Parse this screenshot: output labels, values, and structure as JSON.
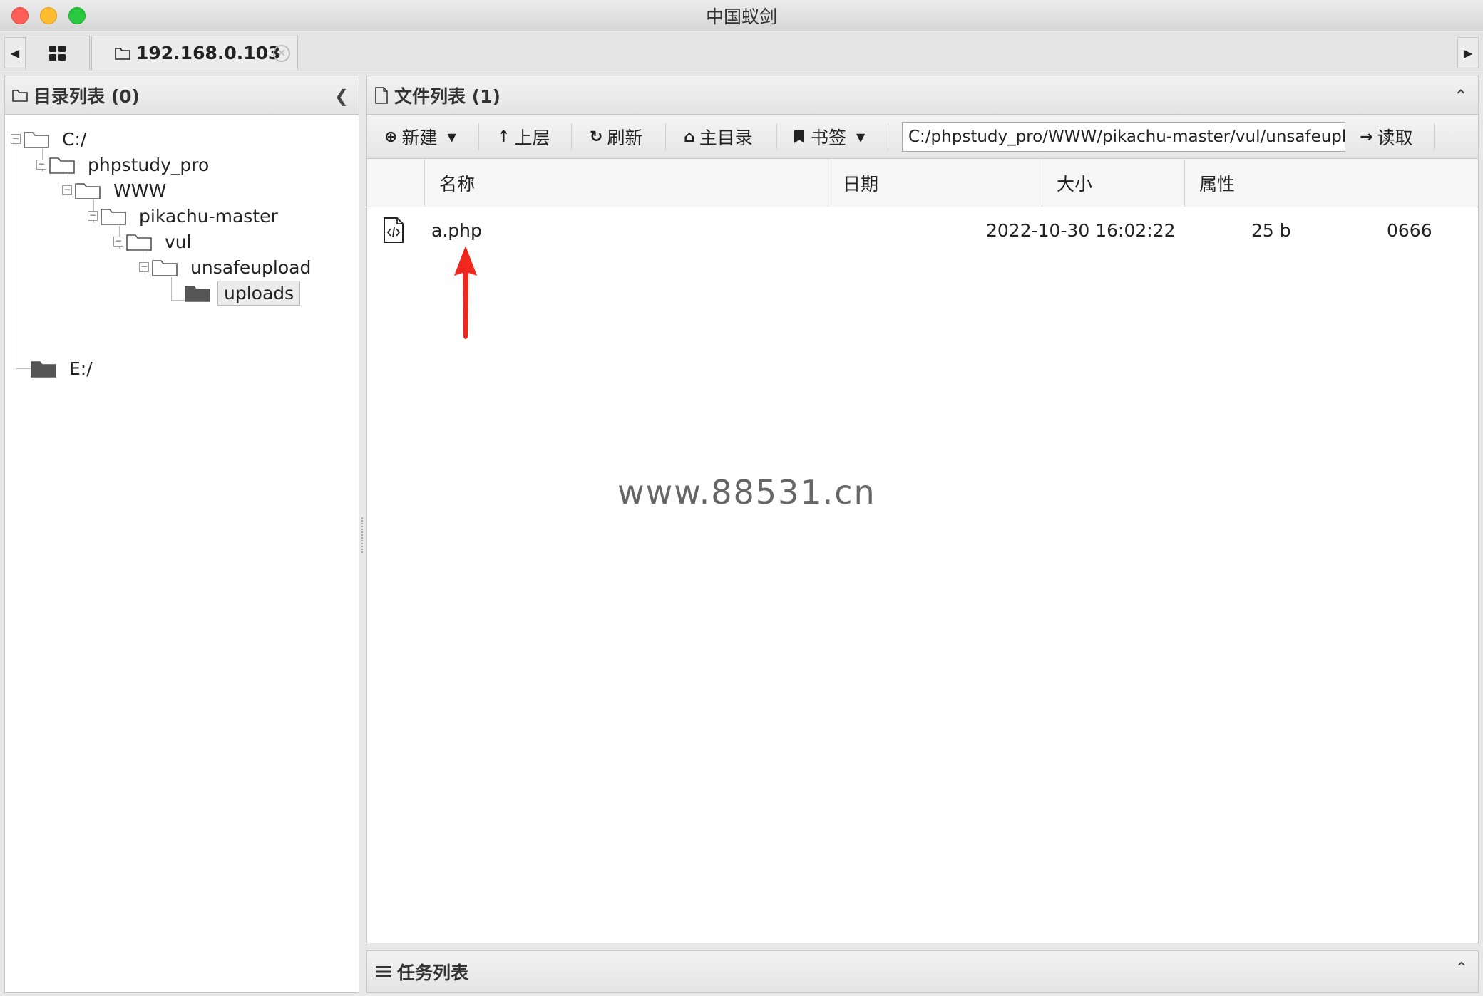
{
  "window": {
    "title": "中国蚁剑"
  },
  "tabs": {
    "host_label": "192.168.0.103"
  },
  "directory_panel": {
    "title": "目录列表 (0)",
    "tree": [
      {
        "label": "C:/",
        "level": 0,
        "expanded": true,
        "filled": false
      },
      {
        "label": "phpstudy_pro",
        "level": 1,
        "expanded": true,
        "filled": false
      },
      {
        "label": "WWW",
        "level": 2,
        "expanded": true,
        "filled": false
      },
      {
        "label": "pikachu-master",
        "level": 3,
        "expanded": true,
        "filled": false
      },
      {
        "label": "vul",
        "level": 4,
        "expanded": true,
        "filled": false
      },
      {
        "label": "unsafeupload",
        "level": 5,
        "expanded": true,
        "filled": false
      },
      {
        "label": "uploads",
        "level": 6,
        "selected": true,
        "filled": true
      },
      {
        "label": "E:/",
        "level": 0,
        "filled": true
      }
    ]
  },
  "file_panel": {
    "title": "文件列表 (1)",
    "toolbar": {
      "new_label": "新建",
      "up_label": "上层",
      "refresh_label": "刷新",
      "home_label": "主目录",
      "bookmark_label": "书签",
      "path_value": "C:/phpstudy_pro/WWW/pikachu-master/vul/unsafeupload/uploads/",
      "read_label": "读取"
    },
    "columns": {
      "name": "名称",
      "date": "日期",
      "size": "大小",
      "attr": "属性"
    },
    "files": [
      {
        "name": "a.php",
        "date": "2022-10-30 16:02:22",
        "size": "25 b",
        "attr": "0666"
      }
    ]
  },
  "task_panel": {
    "title": "任务列表"
  },
  "watermark": "www.88531.cn",
  "colors": {
    "arrow": "#f0271c",
    "selected_bg": "#ececec"
  }
}
